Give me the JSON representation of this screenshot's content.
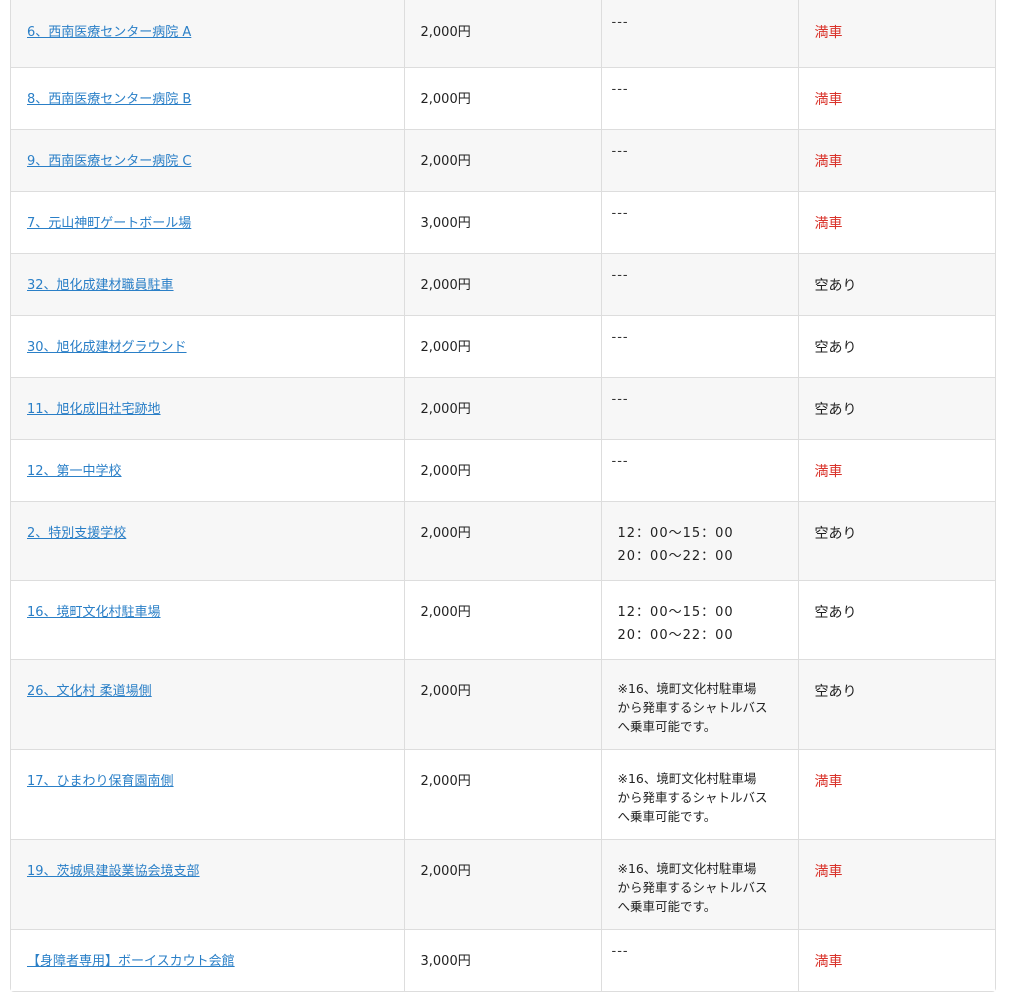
{
  "rows": [
    {
      "name": "6、西南医療センター病院 A",
      "price": "2,000円",
      "info_type": "dash",
      "info": "---",
      "status": "満車",
      "full": true
    },
    {
      "name": "8、西南医療センター病院 B",
      "price": "2,000円",
      "info_type": "dash",
      "info": "---",
      "status": "満車",
      "full": true
    },
    {
      "name": "9、西南医療センター病院 C",
      "price": "2,000円",
      "info_type": "dash",
      "info": "---",
      "status": "満車",
      "full": true
    },
    {
      "name": "7、元山神町ゲートボール場",
      "price": "3,000円",
      "info_type": "dash",
      "info": "---",
      "status": "満車",
      "full": true
    },
    {
      "name": "32、旭化成建材職員駐車",
      "price": "2,000円",
      "info_type": "dash",
      "info": "---",
      "status": "空あり",
      "full": false
    },
    {
      "name": "30、旭化成建材グラウンド",
      "price": "2,000円",
      "info_type": "dash",
      "info": "---",
      "status": "空あり",
      "full": false
    },
    {
      "name": "11、旭化成旧社宅跡地",
      "price": "2,000円",
      "info_type": "dash",
      "info": "---",
      "status": "空あり",
      "full": false
    },
    {
      "name": "12、第一中学校",
      "price": "2,000円",
      "info_type": "dash",
      "info": "---",
      "status": "満車",
      "full": true
    },
    {
      "name": "2、特別支援学校",
      "price": "2,000円",
      "info_type": "hours",
      "hours": [
        "12：00〜15：00",
        "20：00〜22：00"
      ],
      "status": "空あり",
      "full": false
    },
    {
      "name": "16、境町文化村駐車場",
      "price": "2,000円",
      "info_type": "hours",
      "hours": [
        "12：00〜15：00",
        "20：00〜22：00"
      ],
      "status": "空あり",
      "full": false
    },
    {
      "name": "26、文化村 柔道場側",
      "price": "2,000円",
      "info_type": "note",
      "note": [
        "※16、境町文化村駐車場",
        "から発車するシャトルバス",
        "へ乗車可能です。"
      ],
      "status": "空あり",
      "full": false
    },
    {
      "name": "17、ひまわり保育園南側",
      "price": "2,000円",
      "info_type": "note",
      "note": [
        "※16、境町文化村駐車場",
        "から発車するシャトルバス",
        "へ乗車可能です。"
      ],
      "status": "満車",
      "full": true
    },
    {
      "name": "19、茨城県建設業協会境支部",
      "price": "2,000円",
      "info_type": "note",
      "note": [
        "※16、境町文化村駐車場",
        "から発車するシャトルバス",
        "へ乗車可能です。"
      ],
      "status": "満車",
      "full": true
    },
    {
      "name": "【身障者専用】ボーイスカウト会館",
      "price": "3,000円",
      "info_type": "dash",
      "info": "---",
      "status": "満車",
      "full": true
    }
  ]
}
